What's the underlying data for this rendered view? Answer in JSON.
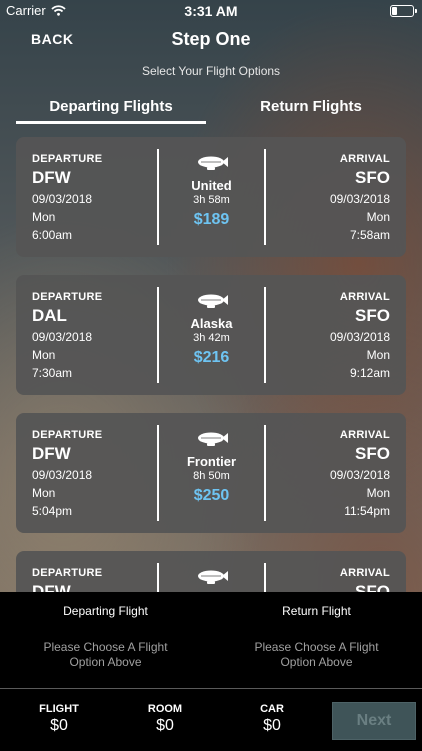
{
  "status_bar": {
    "carrier": "Carrier",
    "time": "3:31 AM"
  },
  "header": {
    "back_label": "BACK",
    "title": "Step One",
    "subtitle": "Select Your Flight Options"
  },
  "tabs": [
    {
      "label": "Departing Flights",
      "active": true
    },
    {
      "label": "Return Flights",
      "active": false
    }
  ],
  "flights": [
    {
      "departure_label": "DEPARTURE",
      "from": "DFW",
      "dep_date": "09/03/2018",
      "dep_day": "Mon",
      "dep_time": "6:00am",
      "airline": "United",
      "duration": "3h 58m",
      "price": "$189",
      "arrival_label": "ARRIVAL",
      "to": "SFO",
      "arr_date": "09/03/2018",
      "arr_day": "Mon",
      "arr_time": "7:58am"
    },
    {
      "departure_label": "DEPARTURE",
      "from": "DAL",
      "dep_date": "09/03/2018",
      "dep_day": "Mon",
      "dep_time": "7:30am",
      "airline": "Alaska",
      "duration": "3h 42m",
      "price": "$216",
      "arrival_label": "ARRIVAL",
      "to": "SFO",
      "arr_date": "09/03/2018",
      "arr_day": "Mon",
      "arr_time": "9:12am"
    },
    {
      "departure_label": "DEPARTURE",
      "from": "DFW",
      "dep_date": "09/03/2018",
      "dep_day": "Mon",
      "dep_time": "5:04pm",
      "airline": "Frontier",
      "duration": "8h 50m",
      "price": "$250",
      "arrival_label": "ARRIVAL",
      "to": "SFO",
      "arr_date": "09/03/2018",
      "arr_day": "Mon",
      "arr_time": "11:54pm"
    },
    {
      "departure_label": "DEPARTURE",
      "from": "DFW",
      "dep_date": "",
      "dep_day": "",
      "dep_time": "",
      "airline": "",
      "duration": "",
      "price": "",
      "arrival_label": "ARRIVAL",
      "to": "SFO",
      "arr_date": "",
      "arr_day": "",
      "arr_time": ""
    }
  ],
  "summary": {
    "departing": {
      "label": "Departing Flight",
      "message": "Please Choose A Flight Option Above"
    },
    "return": {
      "label": "Return Flight",
      "message": "Please Choose A Flight Option Above"
    }
  },
  "footer": {
    "flight": {
      "label": "FLIGHT",
      "value": "$0"
    },
    "room": {
      "label": "ROOM",
      "value": "$0"
    },
    "car": {
      "label": "CAR",
      "value": "$0"
    },
    "next_label": "Next"
  },
  "colors": {
    "price": "#6ec4f2",
    "next_button_bg": "#3f5458",
    "card_bg": "#555555"
  },
  "icons": {
    "flight_icon": "airship-icon",
    "signal": "wifi-icon",
    "battery": "battery-icon"
  }
}
